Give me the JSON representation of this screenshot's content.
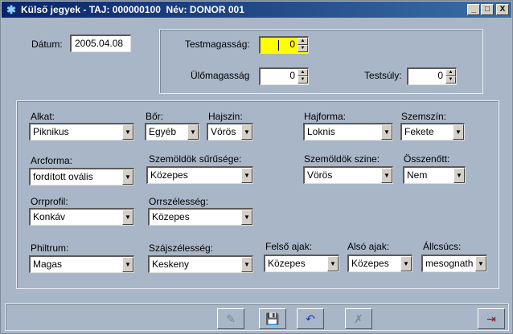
{
  "window": {
    "title": "Külső jegyek - TAJ: 000000100  Név: DONOR 001",
    "buttons": {
      "minimize": "_",
      "maximize": "□",
      "close": "X"
    }
  },
  "top": {
    "datum_label": "Dátum:",
    "datum_value": "2005.04.08",
    "testmagassag_label": "Testmagasság:",
    "testmagassag_value": "0",
    "ulomagassag_label": "Ülőmagasság",
    "ulomagassag_value": "0",
    "testsuly_label": "Testsúly:",
    "testsuly_value": "0"
  },
  "fields": {
    "alkat": {
      "label": "Alkat:",
      "value": "Piknikus"
    },
    "bor": {
      "label": "Bőr:",
      "value": "Egyéb"
    },
    "hajszin": {
      "label": "Hajszin:",
      "value": "Vörös"
    },
    "hajforma": {
      "label": "Hajforma:",
      "value": "Loknis"
    },
    "szemszin": {
      "label": "Szemszín:",
      "value": "Fekete"
    },
    "arcforma": {
      "label": "Arcforma:",
      "value": "fordított ovális"
    },
    "szemoldok_surusege": {
      "label": "Szemöldök sűrűsége:",
      "value": "Közepes"
    },
    "szemoldok_szine": {
      "label": "Szemöldök szine:",
      "value": "Vörös"
    },
    "osszenott": {
      "label": "Összenőtt:",
      "value": "Nem"
    },
    "orrprofil": {
      "label": "Orrprofil:",
      "value": "Konkáv"
    },
    "orrszelesseg": {
      "label": "Orrszélesség:",
      "value": "Közepes"
    },
    "philtrum": {
      "label": "Philtrum:",
      "value": "Magas"
    },
    "szajszelesseg": {
      "label": "Szájszélesség:",
      "value": "Keskeny"
    },
    "felso_ajak": {
      "label": "Felső ajak:",
      "value": "Közepes"
    },
    "also_ajak": {
      "label": "Alsó ajak:",
      "value": "Közepes"
    },
    "allcsucs": {
      "label": "Állcsúcs:",
      "value": "mesognath"
    }
  },
  "icons": {
    "title": "✱",
    "up": "▲",
    "down": "▼",
    "dropdown": "▼",
    "edit": "✎",
    "save": "💾",
    "undo": "↶",
    "delete": "✗",
    "exit": "⇥"
  },
  "colors": {
    "title_start": "#0a246a",
    "title_end": "#3a6ea5",
    "form_bg": "#a9b6c7",
    "highlight_input": "#ffff00"
  }
}
